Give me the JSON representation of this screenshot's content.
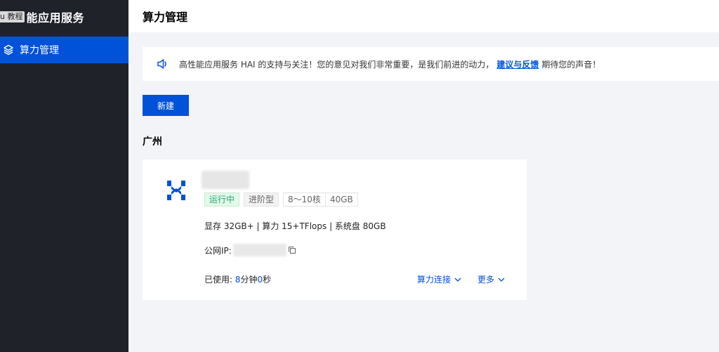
{
  "sidebar": {
    "brand_tag": "u 教程",
    "brand_title": "能应用服务",
    "items": [
      {
        "label": "算力管理",
        "icon": "layers-icon",
        "active": true
      }
    ]
  },
  "header": {
    "title": "算力管理"
  },
  "notice": {
    "icon": "speaker-icon",
    "text_before": "高性能应用服务 HAI 的支持与关注！您的意见对我们非常重要，是我们前进的动力，",
    "link": "建议与反馈",
    "text_after": "期待您的声音！"
  },
  "toolbar": {
    "new_label": "新建"
  },
  "region": "广州",
  "instance": {
    "status": "运行中",
    "tier": "进阶型",
    "cores": "8～10核",
    "memory": "40GB",
    "specs": "显存 32GB+ | 算力 15+TFlops | 系统盘 80GB",
    "ip_label": "公网IP:",
    "usage_prefix": "已使用:",
    "usage_minutes": "8",
    "usage_min_unit": "分钟",
    "usage_seconds": "0",
    "usage_sec_unit": "秒",
    "connect_label": "算力连接",
    "more_label": "更多"
  },
  "colors": {
    "accent": "#0052d9",
    "sidebar_bg": "#20222a",
    "running": "#2ba471"
  }
}
